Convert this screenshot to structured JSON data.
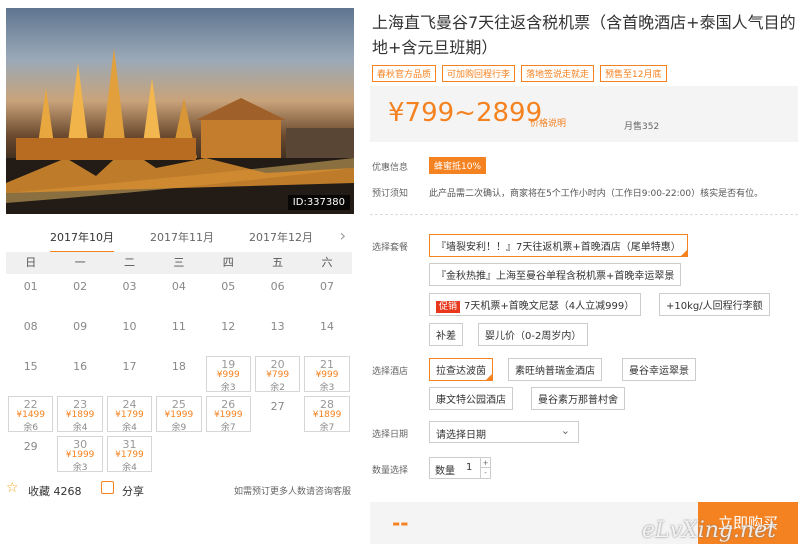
{
  "photo": {
    "id_badge": "ID:337380"
  },
  "months": {
    "m1": "2017年10月",
    "m2": "2017年11月",
    "m3": "2017年12月",
    "next_icon": "chevron-right-icon"
  },
  "weekdays": [
    "日",
    "一",
    "二",
    "三",
    "四",
    "五",
    "六"
  ],
  "days": {
    "d01": "01",
    "d02": "02",
    "d03": "03",
    "d04": "04",
    "d05": "05",
    "d06": "06",
    "d07": "07",
    "d08": "08",
    "d09": "09",
    "d10": "10",
    "d11": "11",
    "d12": "12",
    "d13": "13",
    "d14": "14",
    "d15": "15",
    "d16": "16",
    "d17": "17",
    "d18": "18",
    "d19": {
      "day": "19",
      "price": "¥999",
      "stock": "余3"
    },
    "d20": {
      "day": "20",
      "price": "¥799",
      "stock": "余2"
    },
    "d21": {
      "day": "21",
      "price": "¥999",
      "stock": "余3"
    },
    "d22": {
      "day": "22",
      "price": "¥1499",
      "stock": "余6"
    },
    "d23": {
      "day": "23",
      "price": "¥1899",
      "stock": "余4"
    },
    "d24": {
      "day": "24",
      "price": "¥1799",
      "stock": "余4"
    },
    "d25": {
      "day": "25",
      "price": "¥1999",
      "stock": "余9"
    },
    "d26": {
      "day": "26",
      "price": "¥1999",
      "stock": "余7"
    },
    "d27": "27",
    "d28": {
      "day": "28",
      "price": "¥1899",
      "stock": "余7"
    },
    "d29": "29",
    "d30": {
      "day": "30",
      "price": "¥1999",
      "stock": "余3"
    },
    "d31": {
      "day": "31",
      "price": "¥1799",
      "stock": "余4"
    }
  },
  "footer": {
    "favorites": "收藏 4268",
    "share": "分享",
    "note": "如需预订更多人数请咨询客服"
  },
  "product": {
    "title": "上海直飞曼谷7天往返含税机票（含首晚酒店+泰国人气目的地+含元旦班期）",
    "tags": [
      "春秋官方品质",
      "可加购回程行李",
      "落地签说走就走",
      "预售至12月底"
    ],
    "price": "¥799~2899",
    "price_note": "价格说明",
    "sales": "月售352",
    "promo_label": "优惠信息",
    "promo_badge": "蜂蜜抵10%",
    "notice_label": "预订须知",
    "notice_text": "此产品需二次确认，商家将在5个工作小时内（工作日9:00-22:00）核实是否有位。"
  },
  "package": {
    "label": "选择套餐",
    "opt1": "『墙裂安利！！』7天往返机票+首晚酒店（尾单特惠）",
    "opt2": "『金秋热推』上海至曼谷单程含税机票+首晚幸运翠景",
    "opt3_badge": "促销",
    "opt3": "7天机票+首晚文尼瑟（4人立减999）",
    "opt4": "+10kg/人回程行李额",
    "opt5": "补差",
    "opt6": "婴儿价（0-2周岁内）"
  },
  "hotel": {
    "label": "选择酒店",
    "h1": "拉查达波茵",
    "h2": "素旺纳普瑞金酒店",
    "h3": "曼谷幸运翠景",
    "h4": "康文特公园酒店",
    "h5": "曼谷素万那普村舍"
  },
  "date": {
    "label": "选择日期",
    "placeholder": "请选择日期"
  },
  "quantity": {
    "label": "数量选择",
    "prefix": "数量",
    "value": "1",
    "up": "+",
    "down": "-"
  },
  "bottom": {
    "total": "--",
    "buy": "立即购买"
  },
  "watermark": "eLvXing.net"
}
